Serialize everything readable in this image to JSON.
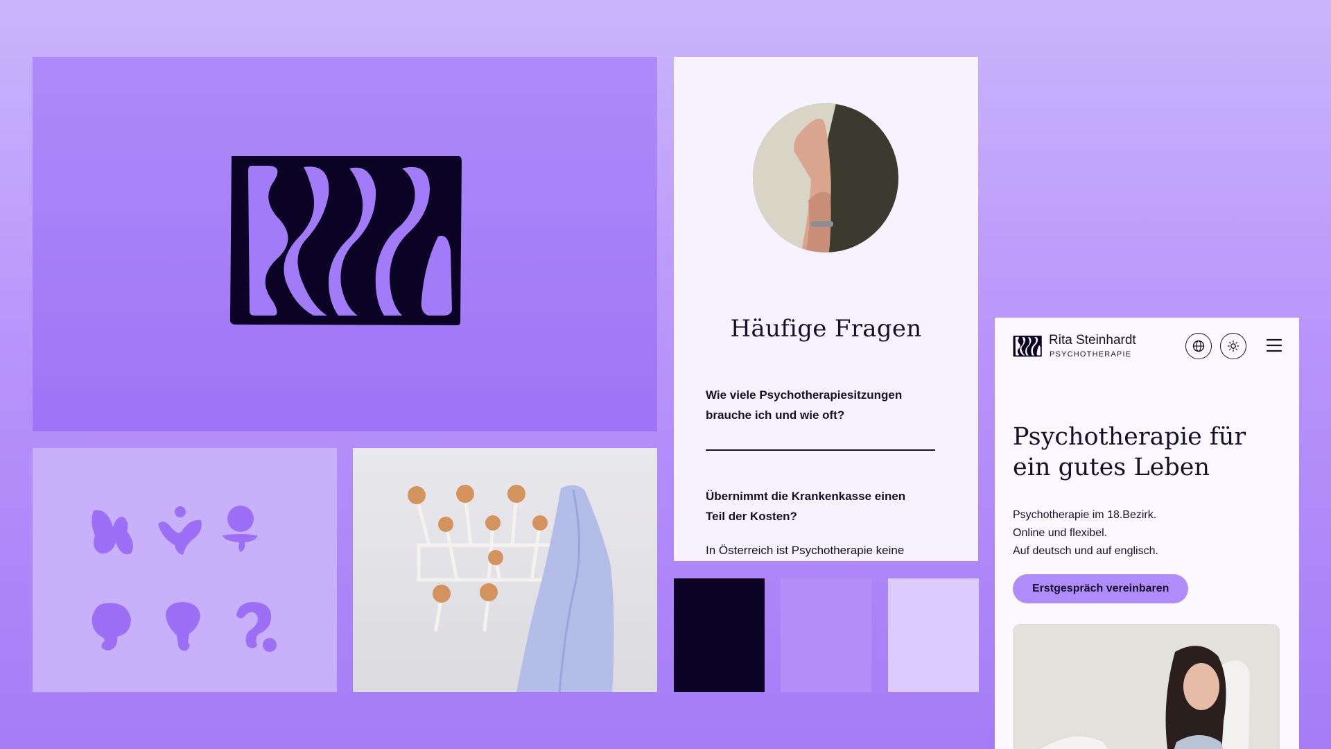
{
  "faq": {
    "title": "Häufige Fragen",
    "question_1_line_1": "Wie viele Psychotherapiesitzungen",
    "question_1_line_2": "brauche ich und wie oft?",
    "question_2_line_1": "Übernimmt die Krankenkasse einen",
    "question_2_line_2": "Teil der Kosten?",
    "answer_2_preview": "In Österreich ist Psychotherapie keine"
  },
  "site": {
    "brand_name": "Rita Steinhardt",
    "brand_subtitle": "PSYCHOTHERAPIE",
    "hero_title_line_1": "Psychotherapie für",
    "hero_title_line_2": "ein gutes Leben",
    "intro_lines": [
      "Psychotherapie im 18.Bezirk.",
      "Online und flexibel.",
      "Auf deutsch und auf englisch."
    ],
    "cta_label": "Erstgespräch vereinbaren",
    "icons": [
      "globe-icon",
      "sun-icon",
      "hamburger-menu-icon"
    ]
  },
  "palette": {
    "swatches": [
      "#0c0425",
      "#b48ffa",
      "#dccbfd"
    ],
    "background": "#b895fb",
    "accent": "#b08cfa",
    "ink": "#14102a"
  },
  "brand_icons": [
    "butterfly-icon",
    "person-heart-icon",
    "figure-icon",
    "speech-bubble-icon",
    "lightbulb-icon",
    "question-mark-icon"
  ]
}
